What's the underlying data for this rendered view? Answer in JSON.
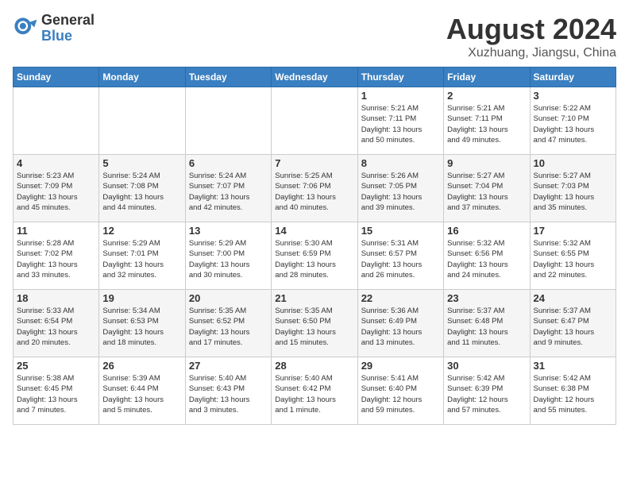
{
  "header": {
    "logo_line1": "General",
    "logo_line2": "Blue",
    "month": "August 2024",
    "location": "Xuzhuang, Jiangsu, China"
  },
  "days_of_week": [
    "Sunday",
    "Monday",
    "Tuesday",
    "Wednesday",
    "Thursday",
    "Friday",
    "Saturday"
  ],
  "weeks": [
    [
      {
        "day": "",
        "info": ""
      },
      {
        "day": "",
        "info": ""
      },
      {
        "day": "",
        "info": ""
      },
      {
        "day": "",
        "info": ""
      },
      {
        "day": "1",
        "info": "Sunrise: 5:21 AM\nSunset: 7:11 PM\nDaylight: 13 hours\nand 50 minutes."
      },
      {
        "day": "2",
        "info": "Sunrise: 5:21 AM\nSunset: 7:11 PM\nDaylight: 13 hours\nand 49 minutes."
      },
      {
        "day": "3",
        "info": "Sunrise: 5:22 AM\nSunset: 7:10 PM\nDaylight: 13 hours\nand 47 minutes."
      }
    ],
    [
      {
        "day": "4",
        "info": "Sunrise: 5:23 AM\nSunset: 7:09 PM\nDaylight: 13 hours\nand 45 minutes."
      },
      {
        "day": "5",
        "info": "Sunrise: 5:24 AM\nSunset: 7:08 PM\nDaylight: 13 hours\nand 44 minutes."
      },
      {
        "day": "6",
        "info": "Sunrise: 5:24 AM\nSunset: 7:07 PM\nDaylight: 13 hours\nand 42 minutes."
      },
      {
        "day": "7",
        "info": "Sunrise: 5:25 AM\nSunset: 7:06 PM\nDaylight: 13 hours\nand 40 minutes."
      },
      {
        "day": "8",
        "info": "Sunrise: 5:26 AM\nSunset: 7:05 PM\nDaylight: 13 hours\nand 39 minutes."
      },
      {
        "day": "9",
        "info": "Sunrise: 5:27 AM\nSunset: 7:04 PM\nDaylight: 13 hours\nand 37 minutes."
      },
      {
        "day": "10",
        "info": "Sunrise: 5:27 AM\nSunset: 7:03 PM\nDaylight: 13 hours\nand 35 minutes."
      }
    ],
    [
      {
        "day": "11",
        "info": "Sunrise: 5:28 AM\nSunset: 7:02 PM\nDaylight: 13 hours\nand 33 minutes."
      },
      {
        "day": "12",
        "info": "Sunrise: 5:29 AM\nSunset: 7:01 PM\nDaylight: 13 hours\nand 32 minutes."
      },
      {
        "day": "13",
        "info": "Sunrise: 5:29 AM\nSunset: 7:00 PM\nDaylight: 13 hours\nand 30 minutes."
      },
      {
        "day": "14",
        "info": "Sunrise: 5:30 AM\nSunset: 6:59 PM\nDaylight: 13 hours\nand 28 minutes."
      },
      {
        "day": "15",
        "info": "Sunrise: 5:31 AM\nSunset: 6:57 PM\nDaylight: 13 hours\nand 26 minutes."
      },
      {
        "day": "16",
        "info": "Sunrise: 5:32 AM\nSunset: 6:56 PM\nDaylight: 13 hours\nand 24 minutes."
      },
      {
        "day": "17",
        "info": "Sunrise: 5:32 AM\nSunset: 6:55 PM\nDaylight: 13 hours\nand 22 minutes."
      }
    ],
    [
      {
        "day": "18",
        "info": "Sunrise: 5:33 AM\nSunset: 6:54 PM\nDaylight: 13 hours\nand 20 minutes."
      },
      {
        "day": "19",
        "info": "Sunrise: 5:34 AM\nSunset: 6:53 PM\nDaylight: 13 hours\nand 18 minutes."
      },
      {
        "day": "20",
        "info": "Sunrise: 5:35 AM\nSunset: 6:52 PM\nDaylight: 13 hours\nand 17 minutes."
      },
      {
        "day": "21",
        "info": "Sunrise: 5:35 AM\nSunset: 6:50 PM\nDaylight: 13 hours\nand 15 minutes."
      },
      {
        "day": "22",
        "info": "Sunrise: 5:36 AM\nSunset: 6:49 PM\nDaylight: 13 hours\nand 13 minutes."
      },
      {
        "day": "23",
        "info": "Sunrise: 5:37 AM\nSunset: 6:48 PM\nDaylight: 13 hours\nand 11 minutes."
      },
      {
        "day": "24",
        "info": "Sunrise: 5:37 AM\nSunset: 6:47 PM\nDaylight: 13 hours\nand 9 minutes."
      }
    ],
    [
      {
        "day": "25",
        "info": "Sunrise: 5:38 AM\nSunset: 6:45 PM\nDaylight: 13 hours\nand 7 minutes."
      },
      {
        "day": "26",
        "info": "Sunrise: 5:39 AM\nSunset: 6:44 PM\nDaylight: 13 hours\nand 5 minutes."
      },
      {
        "day": "27",
        "info": "Sunrise: 5:40 AM\nSunset: 6:43 PM\nDaylight: 13 hours\nand 3 minutes."
      },
      {
        "day": "28",
        "info": "Sunrise: 5:40 AM\nSunset: 6:42 PM\nDaylight: 13 hours\nand 1 minute."
      },
      {
        "day": "29",
        "info": "Sunrise: 5:41 AM\nSunset: 6:40 PM\nDaylight: 12 hours\nand 59 minutes."
      },
      {
        "day": "30",
        "info": "Sunrise: 5:42 AM\nSunset: 6:39 PM\nDaylight: 12 hours\nand 57 minutes."
      },
      {
        "day": "31",
        "info": "Sunrise: 5:42 AM\nSunset: 6:38 PM\nDaylight: 12 hours\nand 55 minutes."
      }
    ]
  ]
}
